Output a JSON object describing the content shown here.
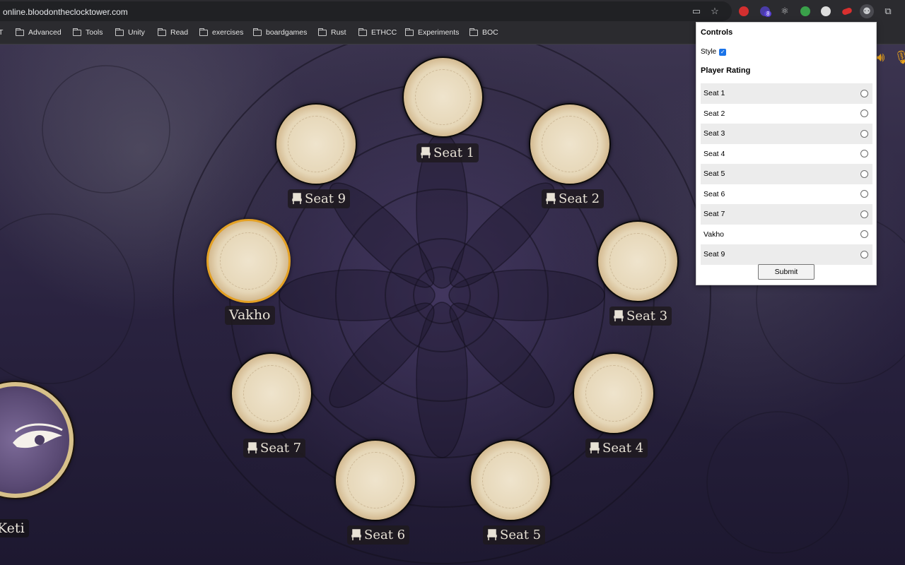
{
  "browser": {
    "url": "online.bloodontheclocktower.com",
    "bookmarks_prefix": "T",
    "bookmarks": [
      "Advanced",
      "Tools",
      "Unity",
      "Read",
      "exercises",
      "boardgames",
      "Rust",
      "ETHCC",
      "Experiments",
      "BOC"
    ],
    "extension_badge": "8"
  },
  "game": {
    "seats": [
      {
        "label": "Seat 1",
        "active": false
      },
      {
        "label": "Seat 2",
        "active": false
      },
      {
        "label": "Seat 3",
        "active": false
      },
      {
        "label": "Seat 4",
        "active": false
      },
      {
        "label": "Seat 5",
        "active": false
      },
      {
        "label": "Seat 6",
        "active": false
      },
      {
        "label": "Seat 7",
        "active": false
      },
      {
        "label": "Vakho",
        "active": true
      },
      {
        "label": "Seat 9",
        "active": false
      }
    ],
    "storyteller": "Keti",
    "accent_color": "#e4a124"
  },
  "popup": {
    "title": "Controls",
    "style_label": "Style",
    "style_checked": true,
    "rating_title": "Player Rating",
    "players": [
      "Seat 1",
      "Seat 2",
      "Seat 3",
      "Seat 4",
      "Seat 5",
      "Seat 6",
      "Seat 7",
      "Vakho",
      "Seat 9"
    ],
    "submit_label": "Submit"
  }
}
